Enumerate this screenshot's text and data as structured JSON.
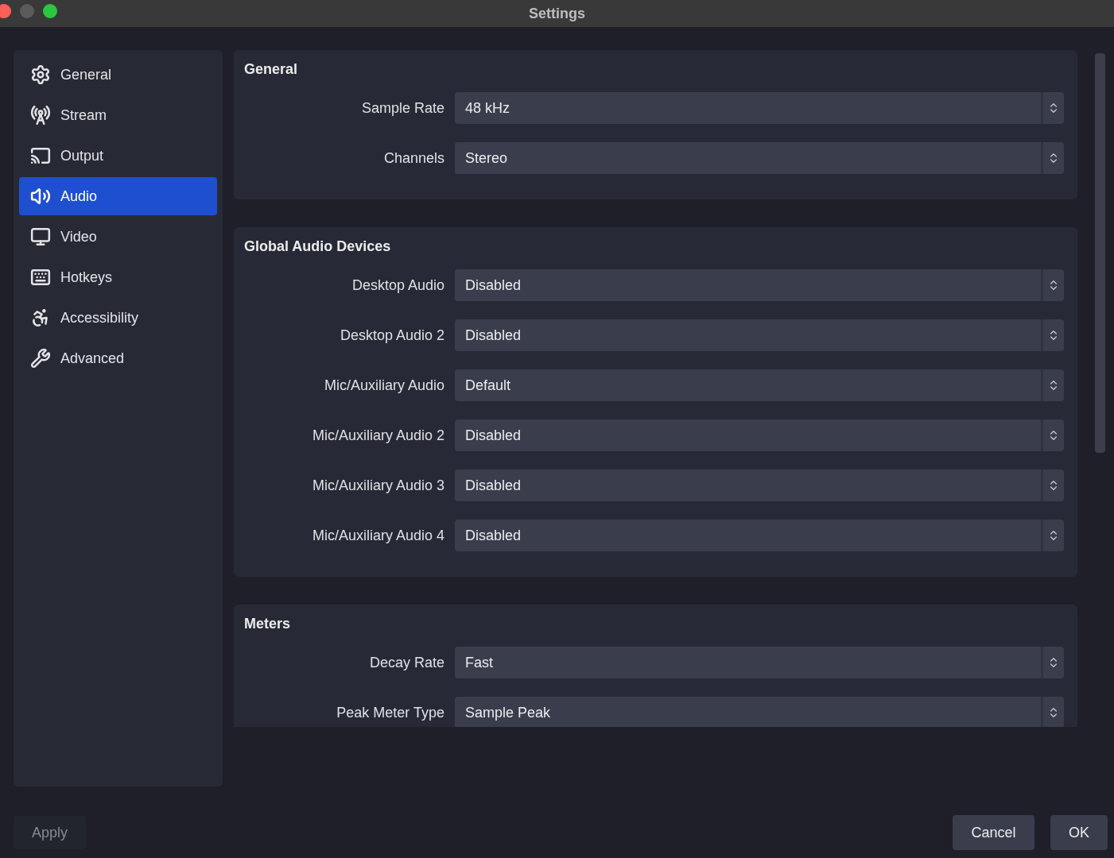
{
  "window": {
    "title": "Settings"
  },
  "sidebar": {
    "items": [
      {
        "label": "General",
        "selected": false
      },
      {
        "label": "Stream",
        "selected": false
      },
      {
        "label": "Output",
        "selected": false
      },
      {
        "label": "Audio",
        "selected": true
      },
      {
        "label": "Video",
        "selected": false
      },
      {
        "label": "Hotkeys",
        "selected": false
      },
      {
        "label": "Accessibility",
        "selected": false
      },
      {
        "label": "Advanced",
        "selected": false
      }
    ]
  },
  "sections": [
    {
      "title": "General",
      "rows": [
        {
          "label": "Sample Rate",
          "value": "48 kHz"
        },
        {
          "label": "Channels",
          "value": "Stereo"
        }
      ]
    },
    {
      "title": "Global Audio Devices",
      "rows": [
        {
          "label": "Desktop Audio",
          "value": "Disabled"
        },
        {
          "label": "Desktop Audio 2",
          "value": "Disabled"
        },
        {
          "label": "Mic/Auxiliary Audio",
          "value": "Default"
        },
        {
          "label": "Mic/Auxiliary Audio 2",
          "value": "Disabled"
        },
        {
          "label": "Mic/Auxiliary Audio 3",
          "value": "Disabled"
        },
        {
          "label": "Mic/Auxiliary Audio 4",
          "value": "Disabled"
        }
      ]
    },
    {
      "title": "Meters",
      "rows": [
        {
          "label": "Decay Rate",
          "value": "Fast"
        },
        {
          "label": "Peak Meter Type",
          "value": "Sample Peak"
        }
      ]
    }
  ],
  "buttons": {
    "apply": {
      "label": "Apply",
      "disabled": true
    },
    "cancel": {
      "label": "Cancel"
    },
    "ok": {
      "label": "OK"
    }
  }
}
